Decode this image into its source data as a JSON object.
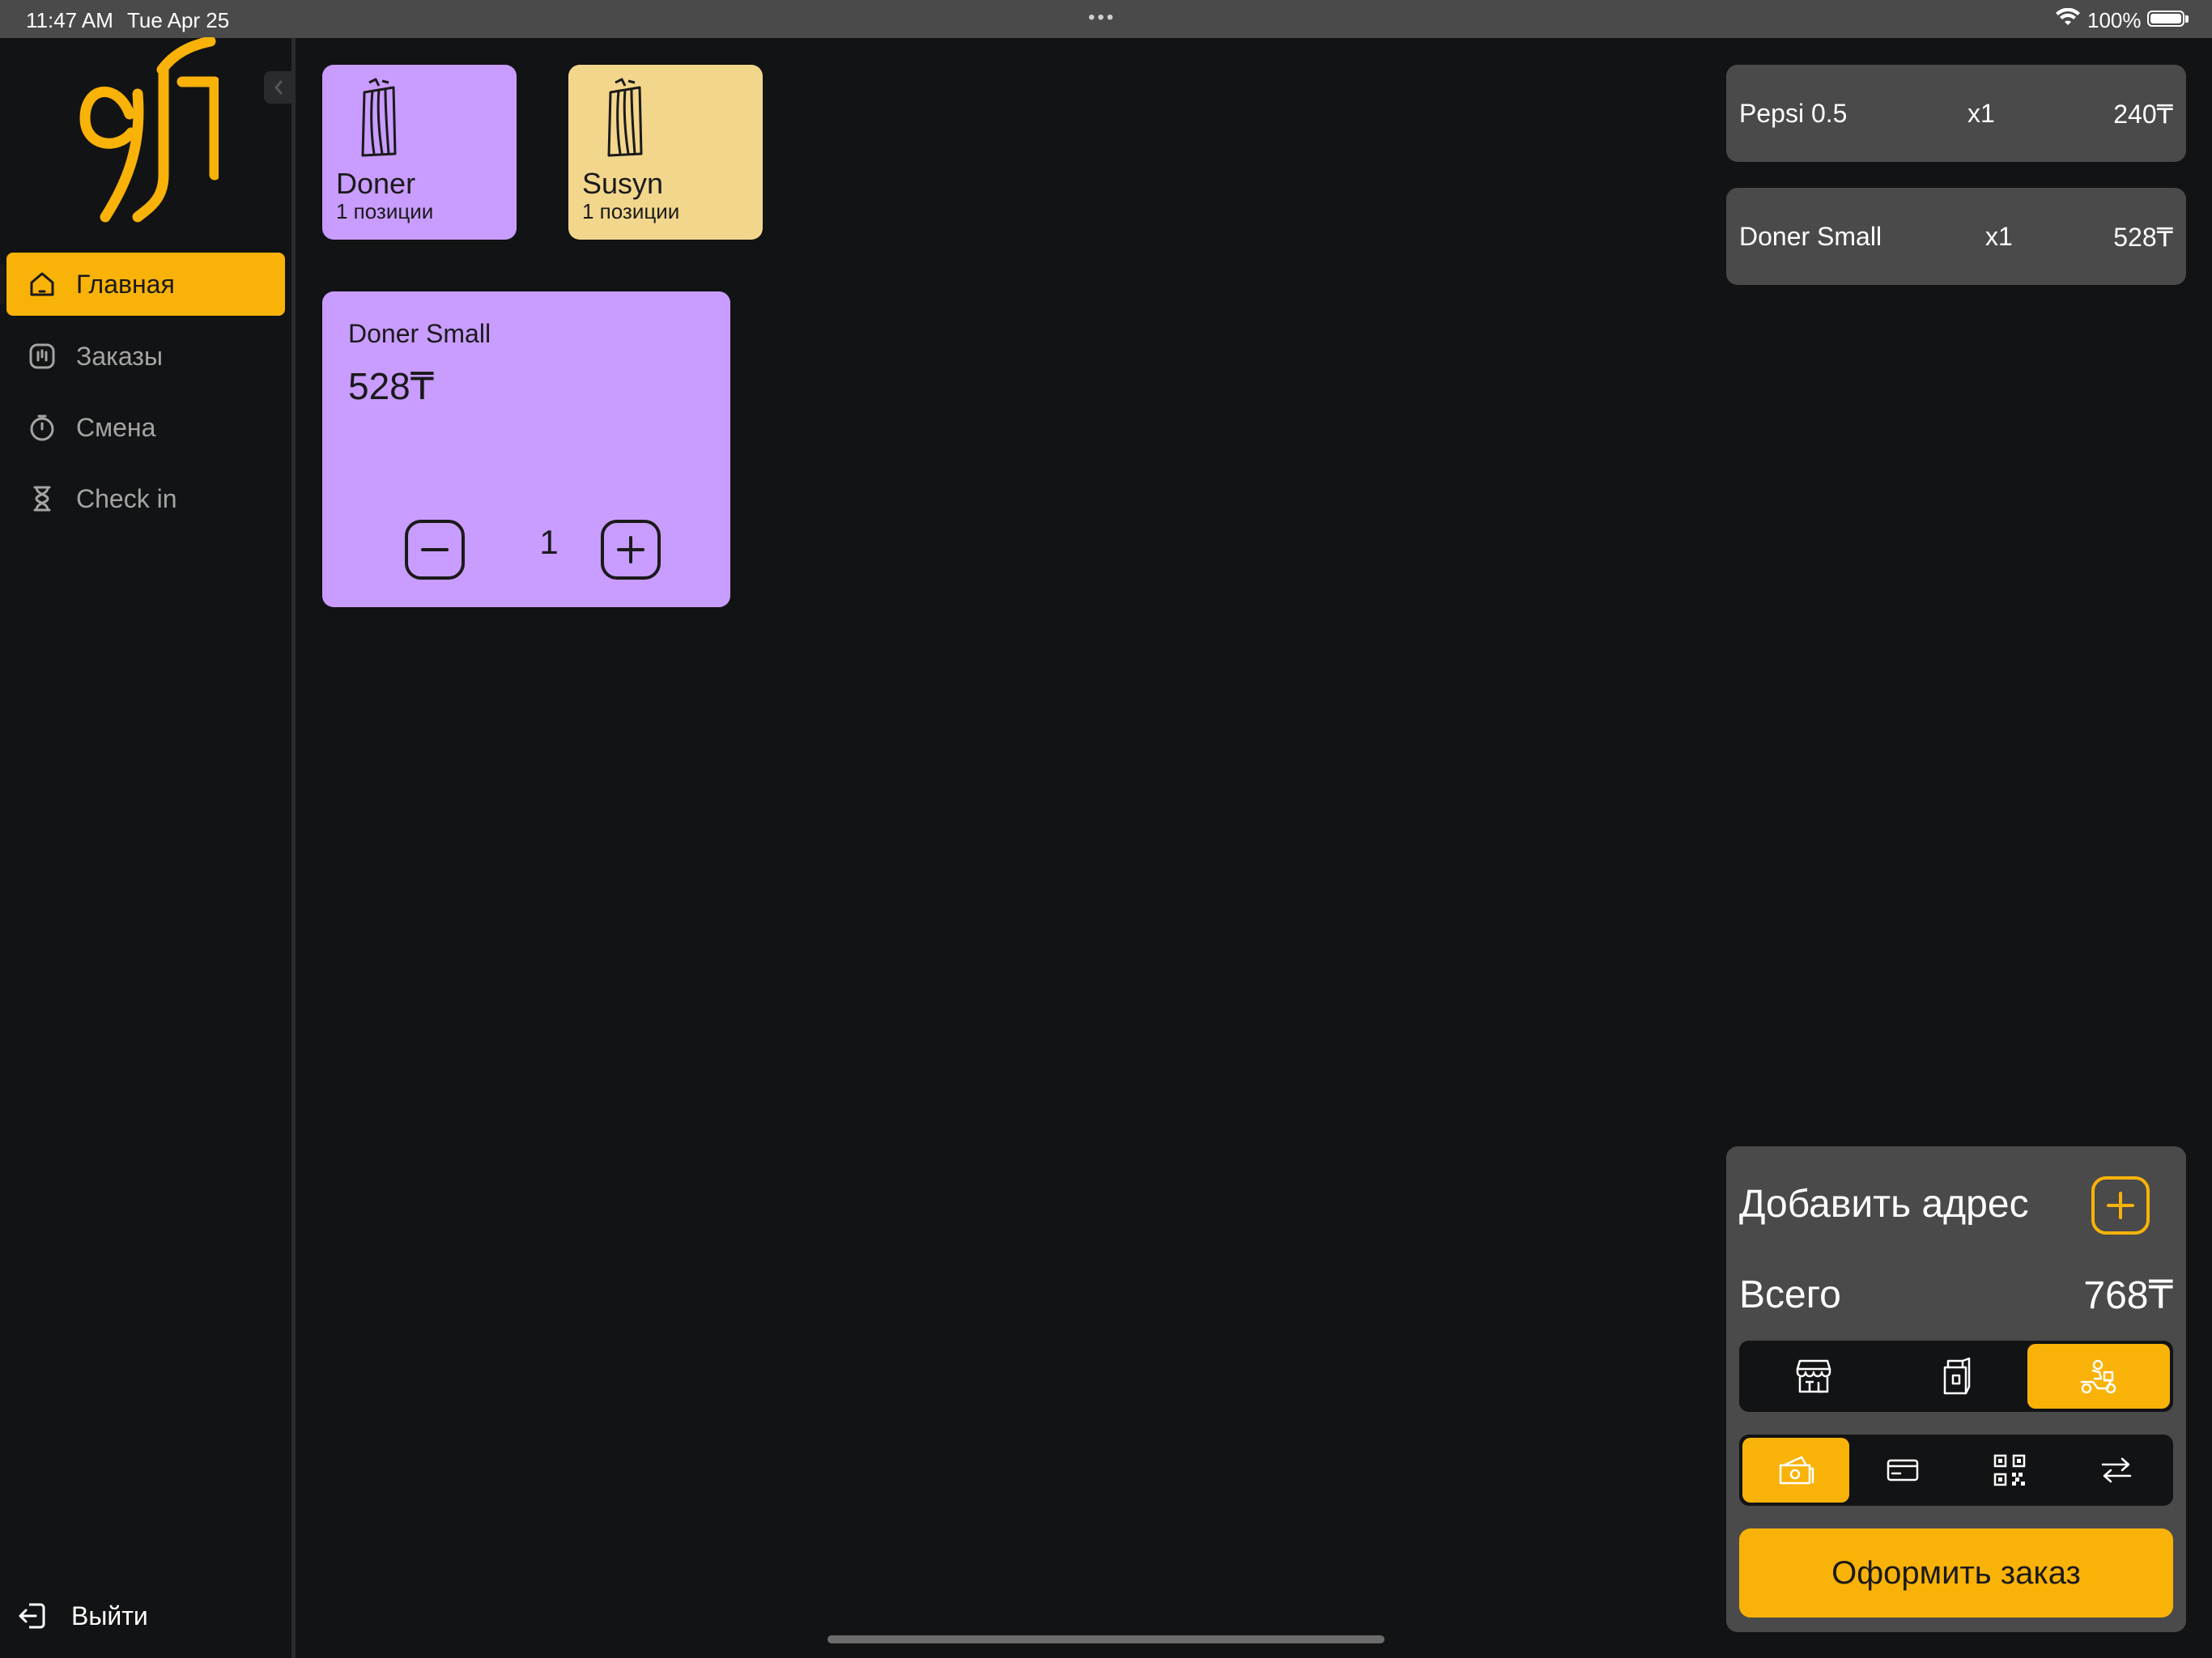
{
  "status_bar": {
    "time": "11:47 AM",
    "date": "Tue Apr 25",
    "battery": "100%"
  },
  "sidebar": {
    "brand": {
      "logo_text": "91"
    },
    "items": [
      {
        "label": "Главная",
        "icon": "home-icon",
        "active": true
      },
      {
        "label": "Заказы",
        "icon": "orders-icon",
        "active": false
      },
      {
        "label": "Смена",
        "icon": "stopwatch-icon",
        "active": false
      },
      {
        "label": "Check in",
        "icon": "hourglass-icon",
        "active": false
      }
    ],
    "logout_label": "Выйти"
  },
  "categories": [
    {
      "name": "Doner",
      "count": "1 позиции",
      "color": "#c99cff",
      "icon": "doner-wrap-icon"
    },
    {
      "name": "Susyn",
      "count": "1 позиции",
      "color": "#f2d68c",
      "icon": "doner-wrap-icon"
    }
  ],
  "products": [
    {
      "name": "Doner Small",
      "price": "528₸",
      "quantity": "1"
    }
  ],
  "order": {
    "lines": [
      {
        "name": "Pepsi 0.5",
        "qty": "x1",
        "price": "240₸"
      },
      {
        "name": "Doner Small",
        "qty": "x1",
        "price": "528₸"
      }
    ],
    "add_address_label": "Добавить адрес",
    "total_label": "Всего",
    "total_value": "768₸",
    "order_types": [
      {
        "icon": "dine-in-icon",
        "active": false
      },
      {
        "icon": "takeaway-bag-icon",
        "active": false
      },
      {
        "icon": "delivery-scooter-icon",
        "active": true
      }
    ],
    "payment_methods": [
      {
        "icon": "cash-icon",
        "active": true
      },
      {
        "icon": "card-icon",
        "active": false
      },
      {
        "icon": "qr-code-icon",
        "active": false
      },
      {
        "icon": "transfer-icon",
        "active": false
      }
    ],
    "submit_label": "Оформить заказ"
  },
  "colors": {
    "accent": "#f9b208",
    "panel": "#4a4a4a",
    "background": "#121314"
  }
}
